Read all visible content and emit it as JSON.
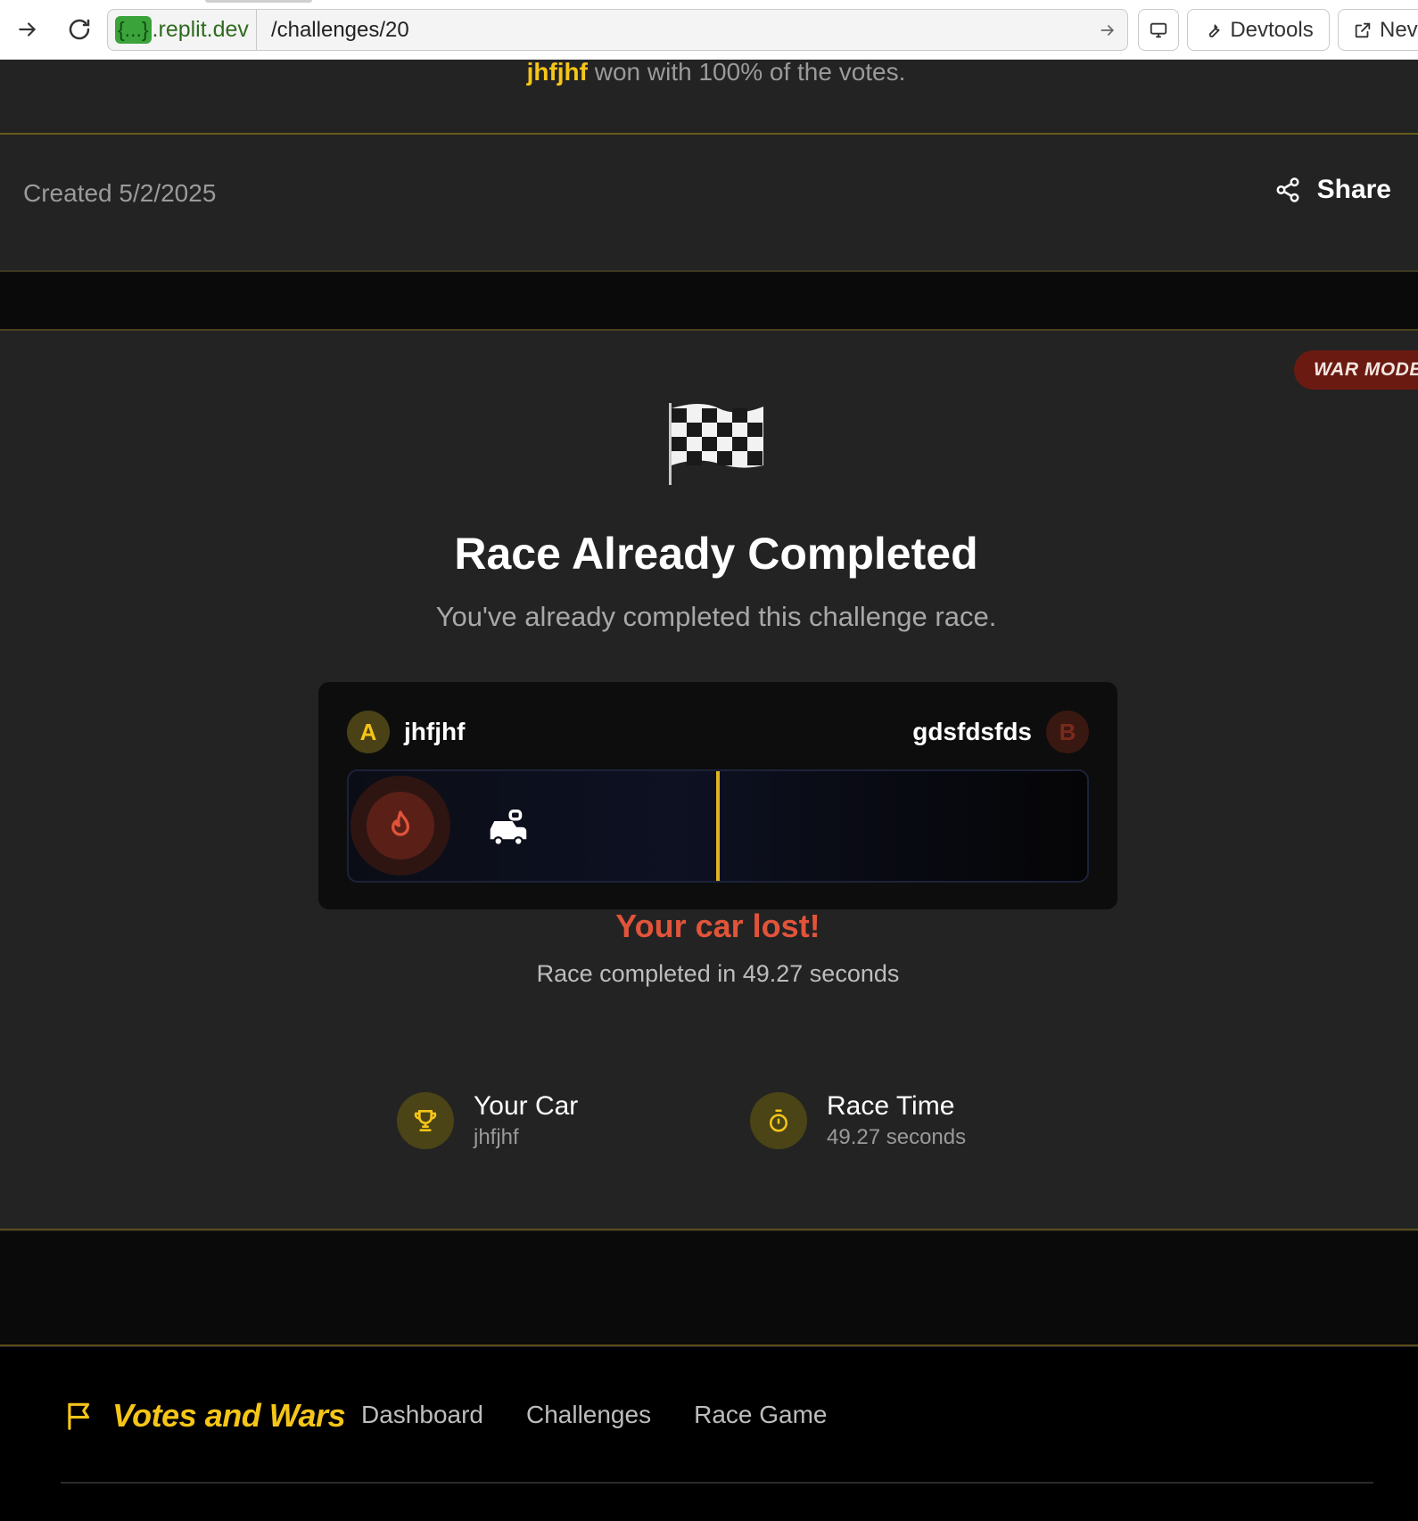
{
  "browser": {
    "host_badge": "{...}",
    "host": ".replit.dev",
    "path": "/challenges/20",
    "devtools_label": "Devtools",
    "new_tab_label": "Nev"
  },
  "winner": {
    "name": "jhfjhf",
    "text": " won with 100% of the votes."
  },
  "meta": {
    "created": "Created 5/2/2025",
    "share_label": "Share"
  },
  "race": {
    "war_mode_label": "WAR MODE",
    "title": "Race Already Completed",
    "subtitle": "You've already completed this challenge race.",
    "player_a": {
      "initial": "A",
      "name": "jhfjhf"
    },
    "player_b": {
      "initial": "B",
      "name": "gdsfdsfds"
    },
    "result": "Your car lost!",
    "completed_text": "Race completed in 49.27 seconds",
    "stats": [
      {
        "label": "Your Car",
        "value": "jhfjhf",
        "icon": "trophy-icon"
      },
      {
        "label": "Race Time",
        "value": "49.27 seconds",
        "icon": "stopwatch-icon"
      }
    ]
  },
  "footer": {
    "brand": "Votes and Wars",
    "links": [
      "Dashboard",
      "Challenges",
      "Race Game"
    ]
  },
  "colors": {
    "accent": "#f5c518",
    "lost": "#e1543a",
    "background": "#232323"
  }
}
